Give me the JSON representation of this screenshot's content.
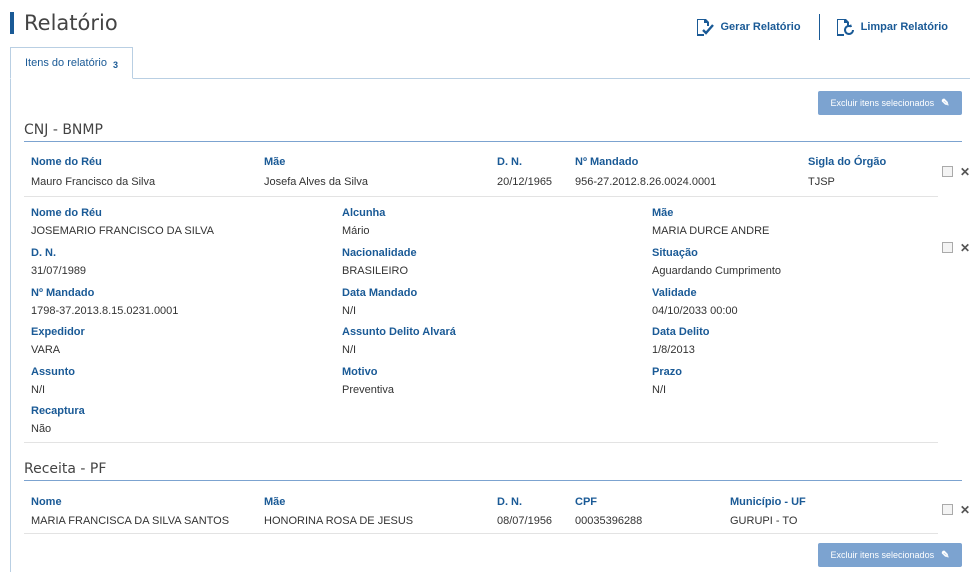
{
  "header": {
    "title": "Relatório",
    "generate_label": "Gerar Relatório",
    "clear_label": "Limpar Relatório",
    "accent_color": "#1a5a96"
  },
  "tab": {
    "label": "Itens do relatório",
    "count": "3"
  },
  "actions": {
    "delete_selected_label": "Excluir itens selecionados"
  },
  "sections": [
    {
      "title": "CNJ - BNMP",
      "record1": {
        "labels": [
          "Nome do Réu",
          "Mãe",
          "D. N.",
          "Nº Mandado",
          "Sigla do Órgão"
        ],
        "values": [
          "Mauro Francisco da Silva",
          "Josefa Alves da Silva",
          "20/12/1965",
          "956-27.2012.8.26.0024.0001",
          "TJSP"
        ]
      },
      "record2": {
        "fields": [
          {
            "label": "Nome do Réu",
            "value": "JOSEMARIO FRANCISCO DA SILVA"
          },
          {
            "label": "Alcunha",
            "value": "Mário"
          },
          {
            "label": "Mãe",
            "value": "MARIA DURCE ANDRE"
          },
          {
            "label": "D. N.",
            "value": "31/07/1989"
          },
          {
            "label": "Nacionalidade",
            "value": "BRASILEIRO"
          },
          {
            "label": "Situação",
            "value": "Aguardando Cumprimento"
          },
          {
            "label": "Nº Mandado",
            "value": "1798-37.2013.8.15.0231.0001"
          },
          {
            "label": "Data Mandado",
            "value": "N/I"
          },
          {
            "label": "Validade",
            "value": "04/10/2033 00:00"
          },
          {
            "label": "Expedidor",
            "value": "VARA"
          },
          {
            "label": "Assunto Delito Alvará",
            "value": "N/I"
          },
          {
            "label": "Data Delito",
            "value": "1/8/2013"
          },
          {
            "label": "Assunto",
            "value": "N/I"
          },
          {
            "label": "Motivo",
            "value": "Preventiva"
          },
          {
            "label": "Prazo",
            "value": "N/I"
          },
          {
            "label": "Recaptura",
            "value": "Não"
          }
        ]
      }
    },
    {
      "title": "Receita - PF",
      "record1": {
        "labels": [
          "Nome",
          "Mãe",
          "D. N.",
          "CPF",
          "Município - UF"
        ],
        "values": [
          "MARIA FRANCISCA DA SILVA SANTOS",
          "HONORINA ROSA DE JESUS",
          "08/07/1956",
          "00035396288",
          "GURUPI - TO"
        ]
      }
    }
  ],
  "icons": {
    "checkbox": "checkbox-icon",
    "delete": "close-icon",
    "edit": "edit-icon"
  }
}
